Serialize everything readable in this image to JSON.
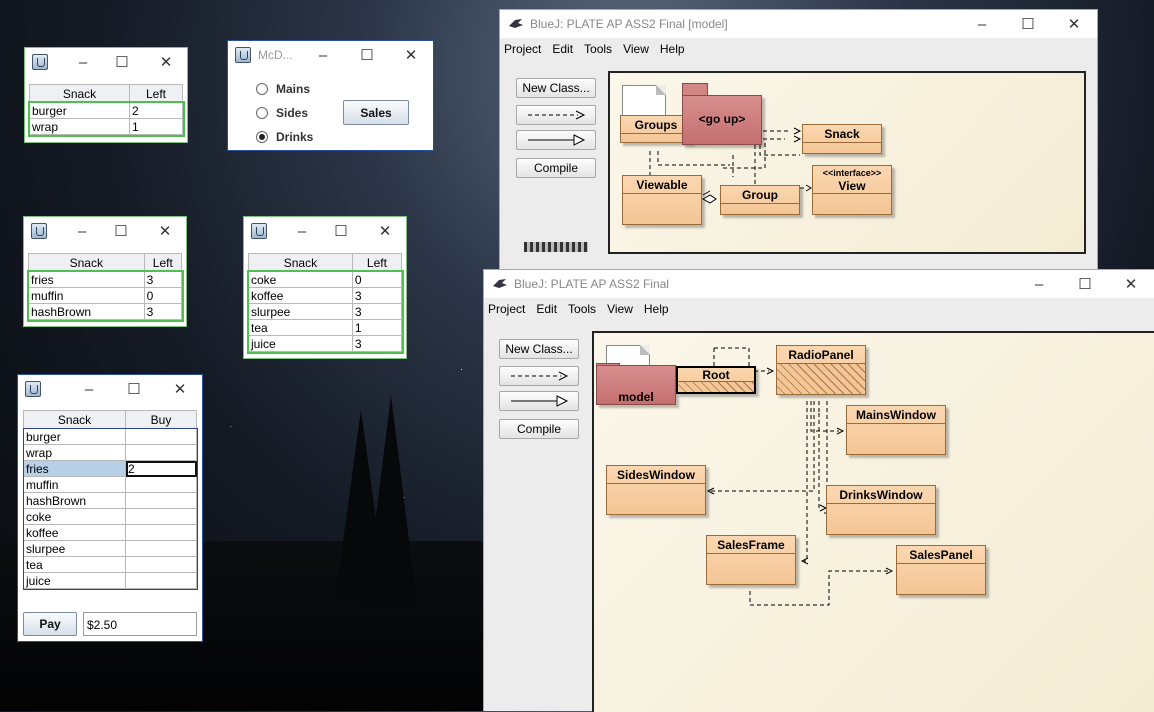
{
  "windows": {
    "mains": {
      "headers": [
        "Snack",
        "Left"
      ],
      "rows": [
        [
          "burger",
          "2"
        ],
        [
          "wrap",
          "1"
        ]
      ]
    },
    "radio": {
      "title": "McD...",
      "options": [
        "Mains",
        "Sides",
        "Drinks"
      ],
      "selected": "Drinks",
      "sales_label": "Sales"
    },
    "sides": {
      "headers": [
        "Snack",
        "Left"
      ],
      "rows": [
        [
          "fries",
          "3"
        ],
        [
          "muffin",
          "0"
        ],
        [
          "hashBrown",
          "3"
        ]
      ]
    },
    "drinks": {
      "headers": [
        "Snack",
        "Left"
      ],
      "rows": [
        [
          "coke",
          "0"
        ],
        [
          "koffee",
          "3"
        ],
        [
          "slurpee",
          "3"
        ],
        [
          "tea",
          "1"
        ],
        [
          "juice",
          "3"
        ]
      ]
    },
    "sales": {
      "headers": [
        "Snack",
        "Buy"
      ],
      "rows": [
        [
          "burger",
          ""
        ],
        [
          "wrap",
          ""
        ],
        [
          "fries",
          "2"
        ],
        [
          "muffin",
          ""
        ],
        [
          "hashBrown",
          ""
        ],
        [
          "coke",
          ""
        ],
        [
          "koffee",
          ""
        ],
        [
          "slurpee",
          ""
        ],
        [
          "tea",
          ""
        ],
        [
          "juice",
          ""
        ]
      ],
      "pay_label": "Pay",
      "total_value": "$2.50"
    }
  },
  "bluej_model": {
    "title": "BlueJ:  PLATE AP ASS2 Final  [model]",
    "menu": [
      "Project",
      "Edit",
      "Tools",
      "View",
      "Help"
    ],
    "new_class": "New Class...",
    "compile": "Compile",
    "classes": {
      "groups": "Groups",
      "go_up": "<go up>",
      "snack": "Snack",
      "viewable": "Viewable",
      "group": "Group",
      "view_stereotype": "<<interface>>",
      "view": "View"
    }
  },
  "bluej_main": {
    "title": "BlueJ:  PLATE AP ASS2 Final",
    "menu": [
      "Project",
      "Edit",
      "Tools",
      "View",
      "Help"
    ],
    "new_class": "New Class...",
    "compile": "Compile",
    "classes": {
      "model": "model",
      "root": "Root",
      "radio_panel": "RadioPanel",
      "mains_window": "MainsWindow",
      "sides_window": "SidesWindow",
      "drinks_window": "DrinksWindow",
      "sales_frame": "SalesFrame",
      "sales_panel": "SalesPanel"
    }
  },
  "icons": {
    "window_icon": "java-cup-icon",
    "minimize": "minimize-icon",
    "maximize": "maximize-icon",
    "close": "close-icon",
    "bluej_logo": "bluej-bird-icon"
  }
}
